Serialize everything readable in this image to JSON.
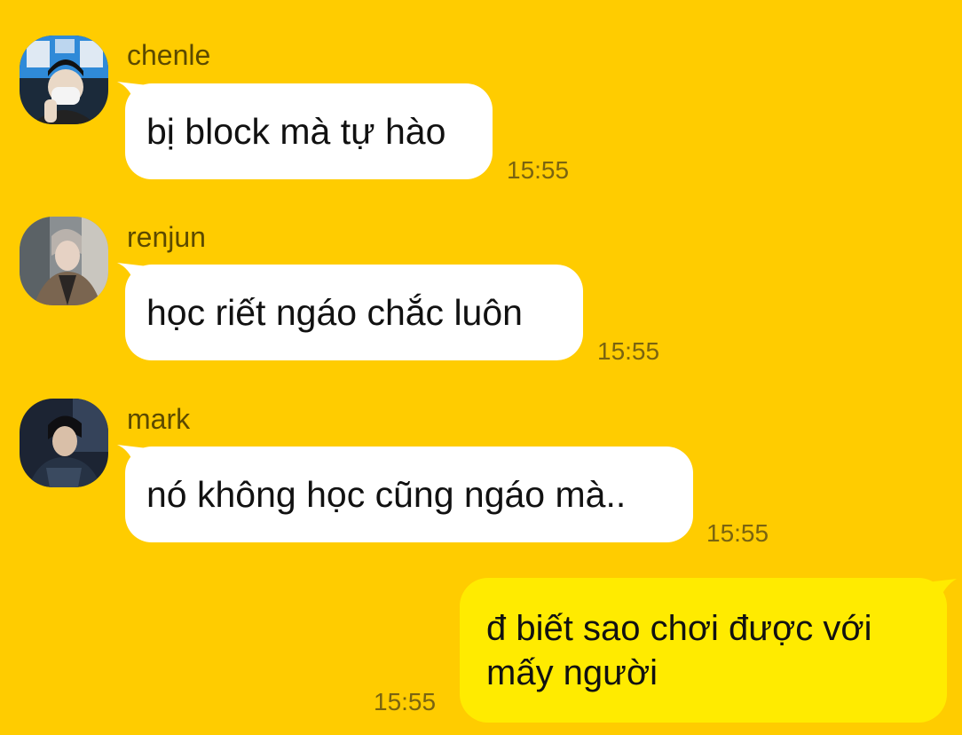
{
  "messages": [
    {
      "sender": "chenle",
      "text": "bị block mà tự hào",
      "time": "15:55",
      "avatar_icon": "avatar-chenle-photo"
    },
    {
      "sender": "renjun",
      "text": "học riết ngáo chắc luôn",
      "time": "15:55",
      "avatar_icon": "avatar-renjun-photo"
    },
    {
      "sender": "mark",
      "text": "nó không học cũng ngáo mà..",
      "time": "15:55",
      "avatar_icon": "avatar-mark-photo"
    }
  ],
  "my_message": {
    "line1": "đ biết sao chơi được với",
    "line2": "mấy người",
    "time": "15:55"
  },
  "colors": {
    "background": "#FFCC00",
    "incoming_bubble": "#FFFFFF",
    "outgoing_bubble": "#FFEB00"
  }
}
